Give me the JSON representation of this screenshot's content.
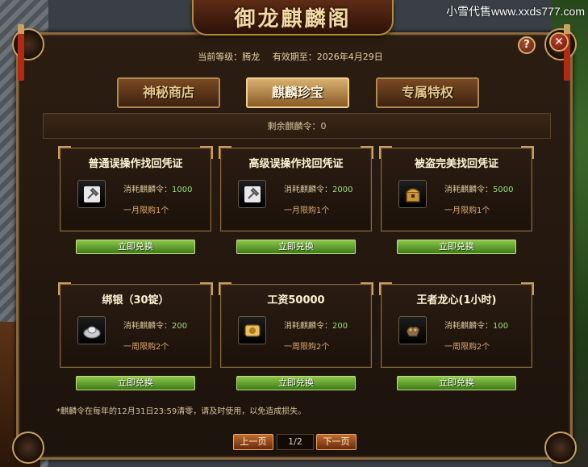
{
  "watermark": "小雪代售www.xxds777.com",
  "title": "御龙麒麟阁",
  "header": {
    "level_label": "当前等级：腾龙",
    "expire_label": "有效期至：2026年4月29日"
  },
  "buttons": {
    "help": "?",
    "close": "✕"
  },
  "tabs": [
    {
      "label": "神秘商店",
      "active": false
    },
    {
      "label": "麒麟珍宝",
      "active": true
    },
    {
      "label": "专属特权",
      "active": false
    }
  ],
  "remaining": "剩余麒麟令：0",
  "redeem_label": "立即兑换",
  "items": [
    {
      "name": "普通误操作找回凭证",
      "cost_label": "消耗麒麟令：",
      "cost": "1000",
      "limit": "一月限购1个",
      "icon": "hammer-icon"
    },
    {
      "name": "高级误操作找回凭证",
      "cost_label": "消耗麒麟令：",
      "cost": "2000",
      "limit": "一月限购1个",
      "icon": "hammer-icon"
    },
    {
      "name": "被盗完美找回凭证",
      "cost_label": "消耗麒麟令：",
      "cost": "5000",
      "limit": "一月限购1个",
      "icon": "chest-icon"
    },
    {
      "name": "绑银（30锭）",
      "cost_label": "消耗麒麟令：",
      "cost": "200",
      "limit": "一周限购2个",
      "icon": "silver-ingot-icon"
    },
    {
      "name": "工资50000",
      "cost_label": "消耗麒麟令：",
      "cost": "200",
      "limit": "一周限购2个",
      "icon": "scroll-icon"
    },
    {
      "name": "王者龙心(1小时)",
      "cost_label": "消耗麒麟令：",
      "cost": "100",
      "limit": "一周限购2个",
      "icon": "dragon-heart-icon"
    }
  ],
  "note": "*麒麟令在每年的12月31日23:59清零，请及时使用，以免造成损失。",
  "pager": {
    "prev": "上一页",
    "page": "1/2",
    "next": "下一页"
  }
}
